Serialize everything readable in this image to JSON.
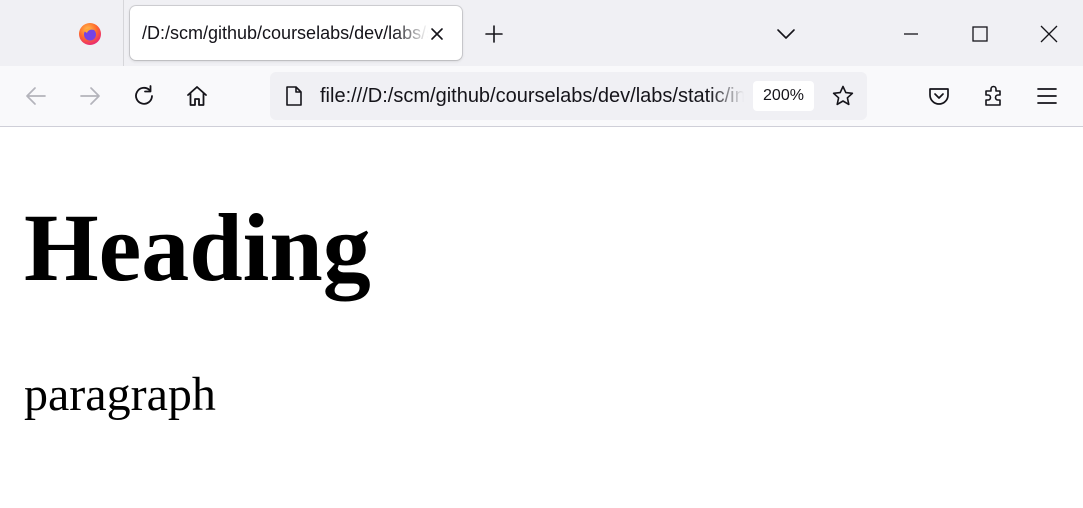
{
  "browser": {
    "tab": {
      "title": "/D:/scm/github/courselabs/dev/labs/static/index.html"
    },
    "urlbar": {
      "url": "file:///D:/scm/github/courselabs/dev/labs/static/index.html",
      "zoom": "200%"
    },
    "icons": {
      "logo": "firefox-logo",
      "tab_close": "close-icon",
      "new_tab": "plus-icon",
      "tab_list": "chevron-down-icon",
      "back": "back-arrow-icon",
      "forward": "forward-arrow-icon",
      "reload": "reload-icon",
      "home": "home-icon",
      "page": "page-icon",
      "bookmark": "star-icon",
      "pocket": "pocket-icon",
      "extensions": "puzzle-icon",
      "menu": "hamburger-icon"
    }
  },
  "page": {
    "heading": "Heading",
    "paragraph": "paragraph"
  }
}
